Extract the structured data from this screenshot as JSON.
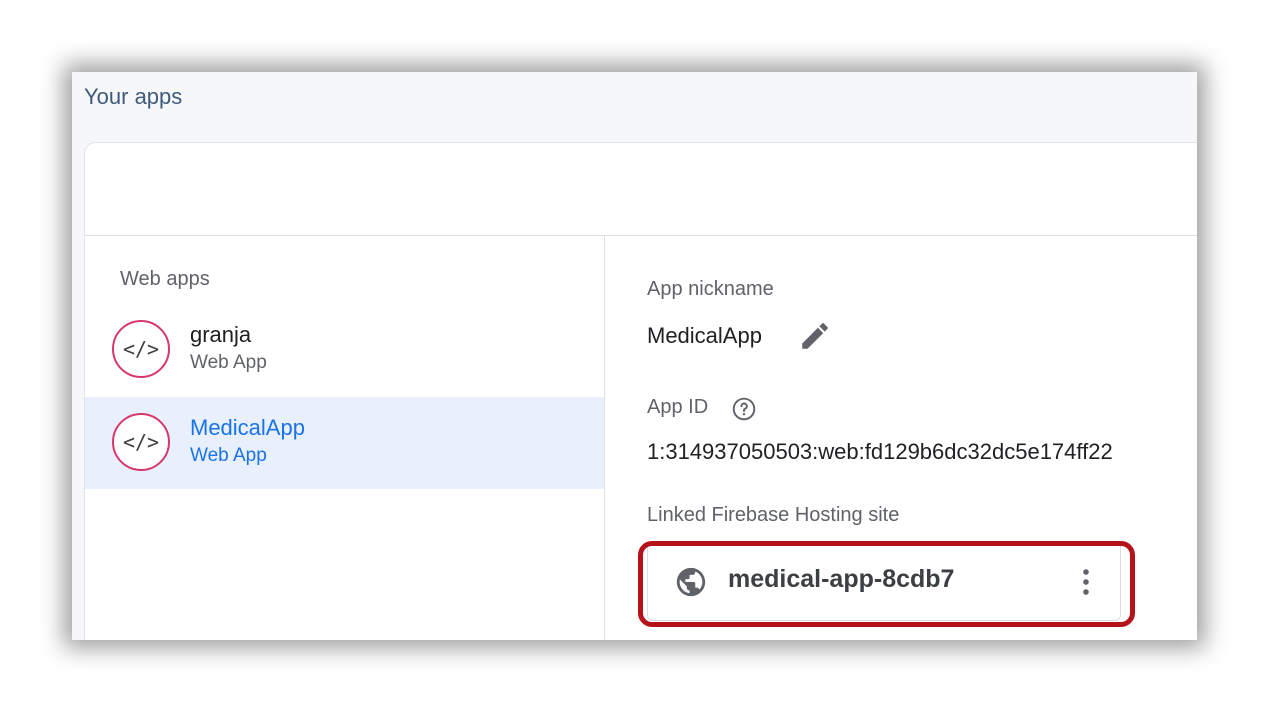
{
  "section_title": "Your apps",
  "sidebar": {
    "heading": "Web apps",
    "apps": [
      {
        "icon": "code-icon",
        "glyph": "</>",
        "name": "granja",
        "type": "Web App",
        "selected": false
      },
      {
        "icon": "code-icon",
        "glyph": "</>",
        "name": "MedicalApp",
        "type": "Web App",
        "selected": true
      }
    ]
  },
  "details": {
    "nickname_label": "App nickname",
    "nickname_value": "MedicalApp",
    "nickname_edit_icon": "pencil-icon",
    "app_id_label": "App ID",
    "app_id_help_icon": "help-circle-icon",
    "app_id_value": "1:314937050503:web:fd129b6dc32dc5e174ff22",
    "hosting_label": "Linked Firebase Hosting site",
    "hosting_site": {
      "icon": "globe-icon",
      "name": "medical-app-8cdb7",
      "menu_icon": "more-vert-icon"
    }
  },
  "colors": {
    "accent": "#1a73e8",
    "selected_bg": "#e8f0fe",
    "app_icon_ring": "#d7386b",
    "highlight_outline": "#b5121b"
  }
}
